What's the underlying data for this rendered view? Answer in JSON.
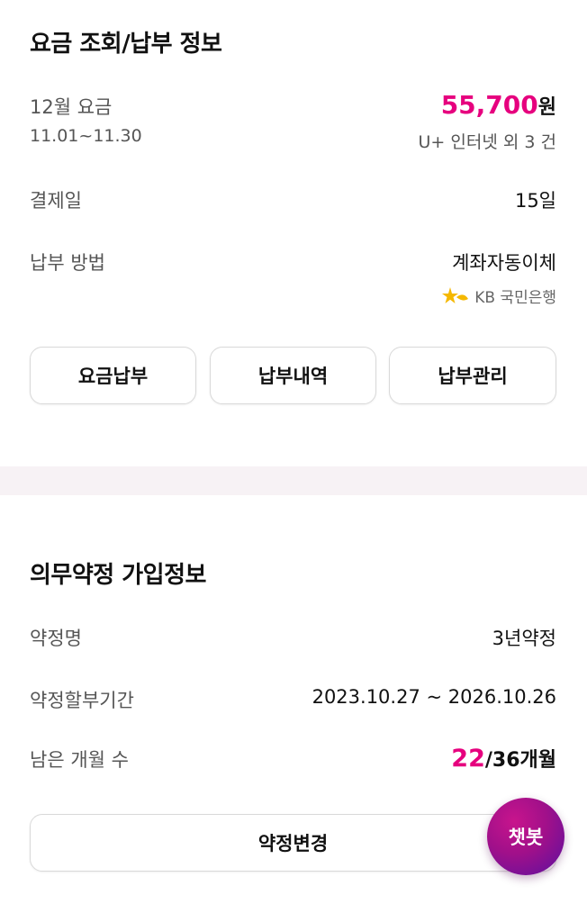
{
  "billing": {
    "title": "요금 조회/납부 정보",
    "month_label": "12월 요금",
    "period": "11.01~11.30",
    "amount": "55,700",
    "amount_unit": "원",
    "services": "U+ 인터넷 외 3 건",
    "payday_label": "결제일",
    "payday_value": "15일",
    "method_label": "납부 방법",
    "method_value": "계좌자동이체",
    "bank_name": "KB 국민은행",
    "buttons": [
      "요금납부",
      "납부내역",
      "납부관리"
    ]
  },
  "contract": {
    "title": "의무약정 가입정보",
    "name_label": "약정명",
    "name_value": "3년약정",
    "period_label": "약정할부기간",
    "period_value": "2023.10.27 ~ 2026.10.26",
    "remaining_label": "남은 개월 수",
    "remaining_current": "22",
    "remaining_total": "/36개월",
    "change_button": "약정변경"
  },
  "chatbot": {
    "label": "챗봇"
  },
  "colors": {
    "accent": "#e6007e",
    "chatbot": "#a0108a",
    "kb_star": "#f5b800"
  },
  "icons": {
    "bank_logo": "kb-star-icon"
  }
}
